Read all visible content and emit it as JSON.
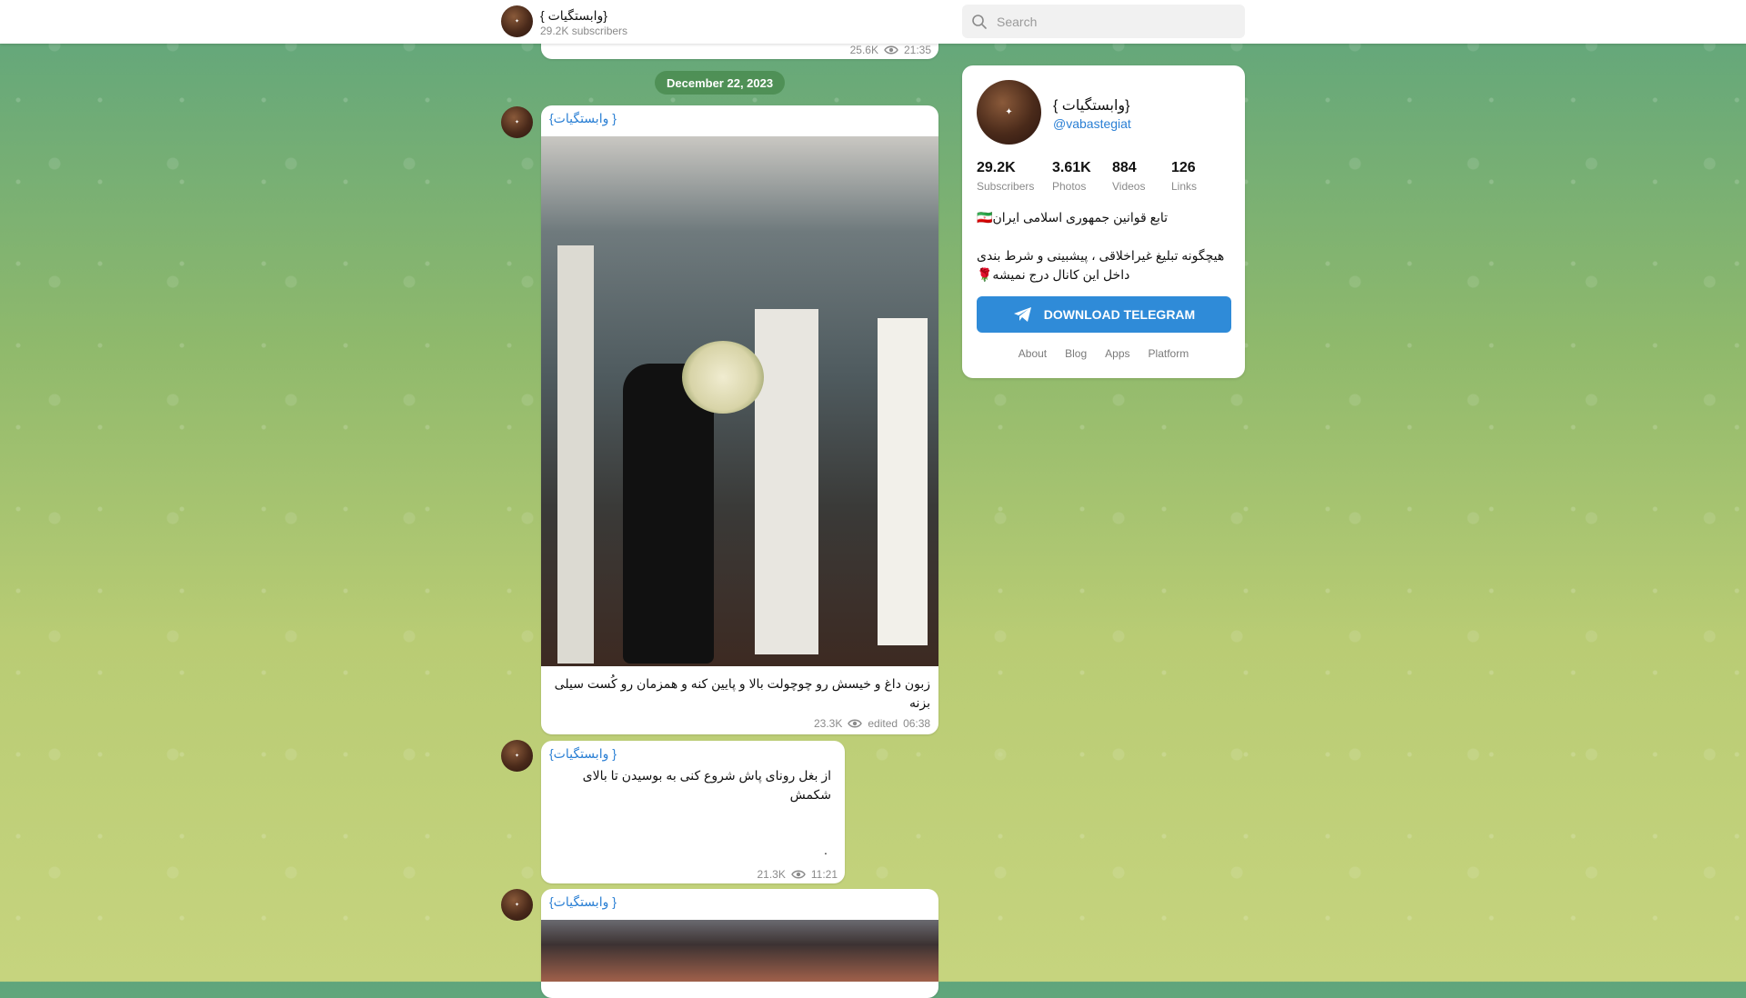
{
  "header": {
    "channel_title": "{ وابستگیات}",
    "subscribers": "29.2K subscribers",
    "search_placeholder": "Search"
  },
  "feed": {
    "top_partial": {
      "views": "25.6K",
      "time": "21:35"
    },
    "date_separator": "December 22, 2023",
    "posts": [
      {
        "author": "{ وابستگیات}",
        "text": "زبون داغ و خیسش رو چوچولت بالا و پایین کنه و همزمان رو کُست سیلی بزنه",
        "views": "23.3K",
        "edited": "edited",
        "time": "06:38"
      },
      {
        "author": "{ وابستگیات}",
        "text": "از بغل رونای پاش شروع کنی به بوسیدن تا بالای شکمش",
        "trailing": ".",
        "views": "21.3K",
        "time": "11:21"
      },
      {
        "author": "{ وابستگیات}"
      }
    ]
  },
  "card": {
    "name": "{ وابستگیات}",
    "username": "@vabastegiat",
    "stats": [
      {
        "value": "29.2K",
        "label": "Subscribers"
      },
      {
        "value": "3.61K",
        "label": "Photos"
      },
      {
        "value": "884",
        "label": "Videos"
      },
      {
        "value": "126",
        "label": "Links"
      }
    ],
    "description_line1": "🇮🇷تابع قوانین جمهوری اسلامی ایران",
    "description_line2": "هیچگونه تبلیغ غیراخلاقی ، پیشبینی و شرط بندی داخل این کانال درج نمیشه🌹",
    "download_button": "DOWNLOAD TELEGRAM",
    "footer_links": [
      "About",
      "Blog",
      "Apps",
      "Platform"
    ]
  },
  "colors": {
    "accent": "#2f8bd8",
    "link": "#2a7fd4",
    "date_pill": "#4a8c50"
  }
}
